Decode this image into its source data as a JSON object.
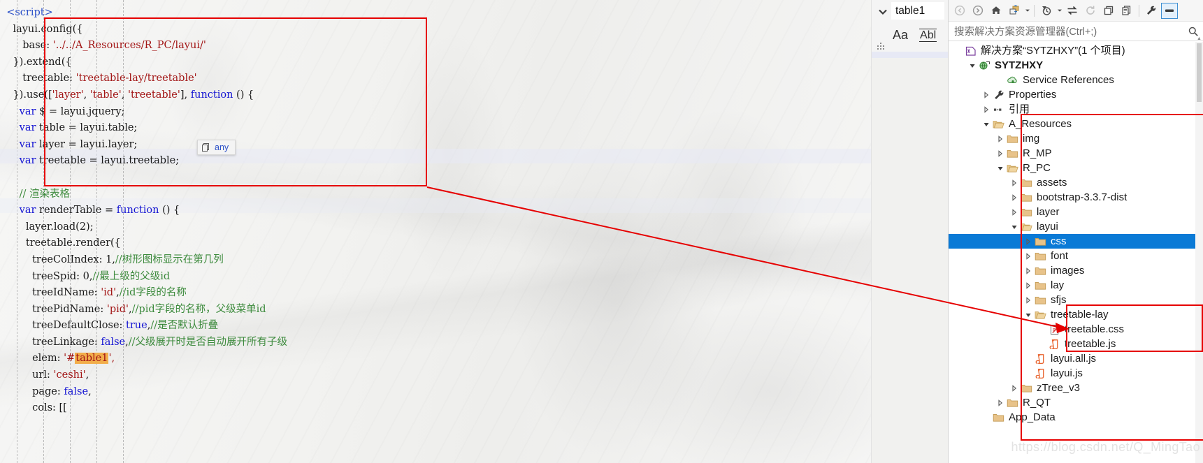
{
  "editor": {
    "tooltip": {
      "label": "any",
      "icon": "copy-icon"
    },
    "code_lines": [
      [
        {
          "t": "<script>",
          "c": "tagc",
          "ind": 2
        }
      ],
      [
        {
          "t": "layui.config({",
          "c": "plain",
          "ind": 4
        }
      ],
      [
        {
          "t": "base: ",
          "c": "plain",
          "ind": 7
        },
        {
          "t": "'../../A_Resources/R_PC/layui/'",
          "c": "str"
        }
      ],
      [
        {
          "t": "}).extend({",
          "c": "plain",
          "ind": 4
        }
      ],
      [
        {
          "t": "treetable: ",
          "c": "plain",
          "ind": 7
        },
        {
          "t": "'treetable-lay/treetable'",
          "c": "str"
        }
      ],
      [
        {
          "t": "}).use([",
          "c": "plain",
          "ind": 4
        },
        {
          "t": "'layer'",
          "c": "str"
        },
        {
          "t": ", ",
          "c": "plain"
        },
        {
          "t": "'table'",
          "c": "str"
        },
        {
          "t": ", ",
          "c": "plain"
        },
        {
          "t": "'treetable'",
          "c": "str"
        },
        {
          "t": "], ",
          "c": "plain"
        },
        {
          "t": "function",
          "c": "kw"
        },
        {
          "t": " () {",
          "c": "plain"
        }
      ],
      [
        {
          "t": "var",
          "c": "kw",
          "ind": 6
        },
        {
          "t": " $ = layui.jquery;",
          "c": "plain"
        }
      ],
      [
        {
          "t": "var",
          "c": "kw",
          "ind": 6
        },
        {
          "t": " table = layui.table;",
          "c": "plain"
        }
      ],
      [
        {
          "t": "var",
          "c": "kw",
          "ind": 6
        },
        {
          "t": " layer = layui.layer;",
          "c": "plain"
        }
      ],
      [
        {
          "t": "var",
          "c": "kw",
          "ind": 6
        },
        {
          "t": " treetable = layui.treetable;",
          "c": "plain"
        }
      ],
      [],
      [
        {
          "t": "// 渲染表格",
          "c": "cmt",
          "ind": 6
        }
      ],
      [
        {
          "t": "var",
          "c": "kw",
          "ind": 6
        },
        {
          "t": " renderTable = ",
          "c": "plain"
        },
        {
          "t": "function",
          "c": "kw"
        },
        {
          "t": " () {",
          "c": "plain"
        }
      ],
      [
        {
          "t": "layer.load(2);",
          "c": "plain",
          "ind": 8
        }
      ],
      [
        {
          "t": "treetable.render({",
          "c": "plain",
          "ind": 8
        }
      ],
      [
        {
          "t": "treeColIndex: 1,",
          "c": "plain",
          "ind": 10
        },
        {
          "t": "//树形图标显示在第几列",
          "c": "cmt"
        }
      ],
      [
        {
          "t": "treeSpid: 0,",
          "c": "plain",
          "ind": 10
        },
        {
          "t": "//最上级的父级id",
          "c": "cmt"
        }
      ],
      [
        {
          "t": "treeIdName: ",
          "c": "plain",
          "ind": 10
        },
        {
          "t": "'id'",
          "c": "str"
        },
        {
          "t": ",",
          "c": "plain"
        },
        {
          "t": "//id字段的名称",
          "c": "cmt"
        }
      ],
      [
        {
          "t": "treePidName: ",
          "c": "plain",
          "ind": 10
        },
        {
          "t": "'pid'",
          "c": "str"
        },
        {
          "t": ",",
          "c": "plain"
        },
        {
          "t": "//pid字段的名称，父级菜单id",
          "c": "cmt"
        }
      ],
      [
        {
          "t": "treeDefaultClose: ",
          "c": "plain",
          "ind": 10
        },
        {
          "t": "true",
          "c": "kw"
        },
        {
          "t": ",",
          "c": "plain"
        },
        {
          "t": "//是否默认折叠",
          "c": "cmt"
        }
      ],
      [
        {
          "t": "treeLinkage: ",
          "c": "plain",
          "ind": 10
        },
        {
          "t": "false",
          "c": "kw"
        },
        {
          "t": ",",
          "c": "plain"
        },
        {
          "t": "//父级展开时是否自动展开所有子级",
          "c": "cmt"
        }
      ],
      [
        {
          "t": "elem: ",
          "c": "plain",
          "ind": 10
        },
        {
          "t": "'#",
          "c": "str"
        },
        {
          "t": "table1",
          "c": "hl-tok"
        },
        {
          "t": "',",
          "c": "str"
        }
      ],
      [
        {
          "t": "url: ",
          "c": "plain",
          "ind": 10
        },
        {
          "t": "'ceshi'",
          "c": "str"
        },
        {
          "t": ",",
          "c": "plain"
        }
      ],
      [
        {
          "t": "page: ",
          "c": "plain",
          "ind": 10
        },
        {
          "t": "false",
          "c": "kw"
        },
        {
          "t": ",",
          "c": "plain"
        }
      ],
      [
        {
          "t": "cols: [[",
          "c": "plain",
          "ind": 10
        }
      ]
    ]
  },
  "find_bar": {
    "chevron_icon": "chevron-down-icon",
    "search_value": "table1",
    "match_case_icon": "match-case-icon",
    "match_case_label": "Aa",
    "match_word_icon": "match-whole-word-icon",
    "match_word_label": "Abl",
    "grip_icon": "resize-grip-icon"
  },
  "solution_explorer": {
    "toolbar": [
      {
        "name": "back-button",
        "icon": "arrow-left-circle-icon",
        "disabled": true
      },
      {
        "name": "forward-button",
        "icon": "arrow-right-circle-icon",
        "disabled": false
      },
      {
        "name": "home-button",
        "icon": "home-icon",
        "disabled": false
      },
      {
        "name": "sync-with-active-document-button",
        "icon": "sync-document-icon",
        "disabled": false
      },
      {
        "name": "sync-dropdown",
        "icon": "chevron-down-icon",
        "disabled": false
      },
      {
        "name": "pending-changes-filter-button",
        "icon": "clock-filter-icon",
        "disabled": false
      },
      {
        "name": "pending-changes-dropdown",
        "icon": "chevron-down-icon",
        "disabled": false
      },
      {
        "name": "sync-views-button",
        "icon": "double-arrow-icon",
        "disabled": false
      },
      {
        "name": "refresh-button",
        "icon": "refresh-icon",
        "disabled": true
      },
      {
        "name": "collapse-all-button",
        "icon": "collapse-all-icon",
        "disabled": false
      },
      {
        "name": "show-all-files-button",
        "icon": "show-all-files-icon",
        "disabled": false
      },
      {
        "name": "properties-button",
        "icon": "wrench-icon",
        "disabled": false
      },
      {
        "name": "preview-selected-items-button",
        "icon": "preview-icon",
        "disabled": false,
        "selected": true
      }
    ],
    "search_placeholder": "搜索解决方案资源管理器(Ctrl+;)",
    "search_icon": "magnifier-icon",
    "tree": [
      {
        "label": "解决方案“SYTZHXY”(1 个项目)",
        "depth": 0,
        "expander": "none",
        "icon": "solution-icon",
        "bold": false,
        "selected": false
      },
      {
        "label": "SYTZHXY",
        "depth": 1,
        "expander": "expanded",
        "icon": "web-project-icon",
        "bold": true,
        "selected": false
      },
      {
        "label": "Service References",
        "depth": 3,
        "expander": "none",
        "icon": "service-ref-icon",
        "bold": false,
        "selected": false
      },
      {
        "label": "Properties",
        "depth": 2,
        "expander": "collapsed",
        "icon": "wrench-icon",
        "bold": false,
        "selected": false
      },
      {
        "label": "引用",
        "depth": 2,
        "expander": "collapsed",
        "icon": "references-icon",
        "bold": false,
        "selected": false
      },
      {
        "label": "A_Resources",
        "depth": 2,
        "expander": "expanded",
        "icon": "folder-open-icon",
        "bold": false,
        "selected": false
      },
      {
        "label": "img",
        "depth": 3,
        "expander": "collapsed",
        "icon": "folder-icon",
        "bold": false,
        "selected": false
      },
      {
        "label": "R_MP",
        "depth": 3,
        "expander": "collapsed",
        "icon": "folder-icon",
        "bold": false,
        "selected": false
      },
      {
        "label": "R_PC",
        "depth": 3,
        "expander": "expanded",
        "icon": "folder-open-icon",
        "bold": false,
        "selected": false
      },
      {
        "label": "assets",
        "depth": 4,
        "expander": "collapsed",
        "icon": "folder-icon",
        "bold": false,
        "selected": false
      },
      {
        "label": "bootstrap-3.3.7-dist",
        "depth": 4,
        "expander": "collapsed",
        "icon": "folder-icon",
        "bold": false,
        "selected": false
      },
      {
        "label": "layer",
        "depth": 4,
        "expander": "collapsed",
        "icon": "folder-icon",
        "bold": false,
        "selected": false
      },
      {
        "label": "layui",
        "depth": 4,
        "expander": "expanded",
        "icon": "folder-open-icon",
        "bold": false,
        "selected": false
      },
      {
        "label": "css",
        "depth": 5,
        "expander": "collapsed",
        "icon": "folder-icon",
        "bold": false,
        "selected": true
      },
      {
        "label": "font",
        "depth": 5,
        "expander": "collapsed",
        "icon": "folder-icon",
        "bold": false,
        "selected": false
      },
      {
        "label": "images",
        "depth": 5,
        "expander": "collapsed",
        "icon": "folder-icon",
        "bold": false,
        "selected": false
      },
      {
        "label": "lay",
        "depth": 5,
        "expander": "collapsed",
        "icon": "folder-icon",
        "bold": false,
        "selected": false
      },
      {
        "label": "sfjs",
        "depth": 5,
        "expander": "collapsed",
        "icon": "folder-icon",
        "bold": false,
        "selected": false
      },
      {
        "label": "treetable-lay",
        "depth": 5,
        "expander": "expanded",
        "icon": "folder-open-icon",
        "bold": false,
        "selected": false
      },
      {
        "label": "treetable.css",
        "depth": 6,
        "expander": "none",
        "icon": "css-file-icon",
        "bold": false,
        "selected": false
      },
      {
        "label": "treetable.js",
        "depth": 6,
        "expander": "none",
        "icon": "js-file-icon",
        "bold": false,
        "selected": false
      },
      {
        "label": "layui.all.js",
        "depth": 5,
        "expander": "none",
        "icon": "js-file-icon",
        "bold": false,
        "selected": false
      },
      {
        "label": "layui.js",
        "depth": 5,
        "expander": "none",
        "icon": "js-file-icon",
        "bold": false,
        "selected": false
      },
      {
        "label": "zTree_v3",
        "depth": 4,
        "expander": "collapsed",
        "icon": "folder-icon",
        "bold": false,
        "selected": false
      },
      {
        "label": "R_QT",
        "depth": 3,
        "expander": "collapsed",
        "icon": "folder-icon",
        "bold": false,
        "selected": false
      },
      {
        "label": "App_Data",
        "depth": 2,
        "expander": "none",
        "icon": "folder-icon",
        "bold": false,
        "selected": false
      }
    ]
  },
  "annotations": {
    "box_code_label": "layui config/extend/use block",
    "box_tree_outer_label": "A_Resources folder subtree",
    "box_tree_inner_label": "treetable-lay folder contents",
    "arrow_label": "code-to-file arrow",
    "color": "#e60000"
  },
  "watermark": "https://blog.csdn.net/Q_MingTao"
}
